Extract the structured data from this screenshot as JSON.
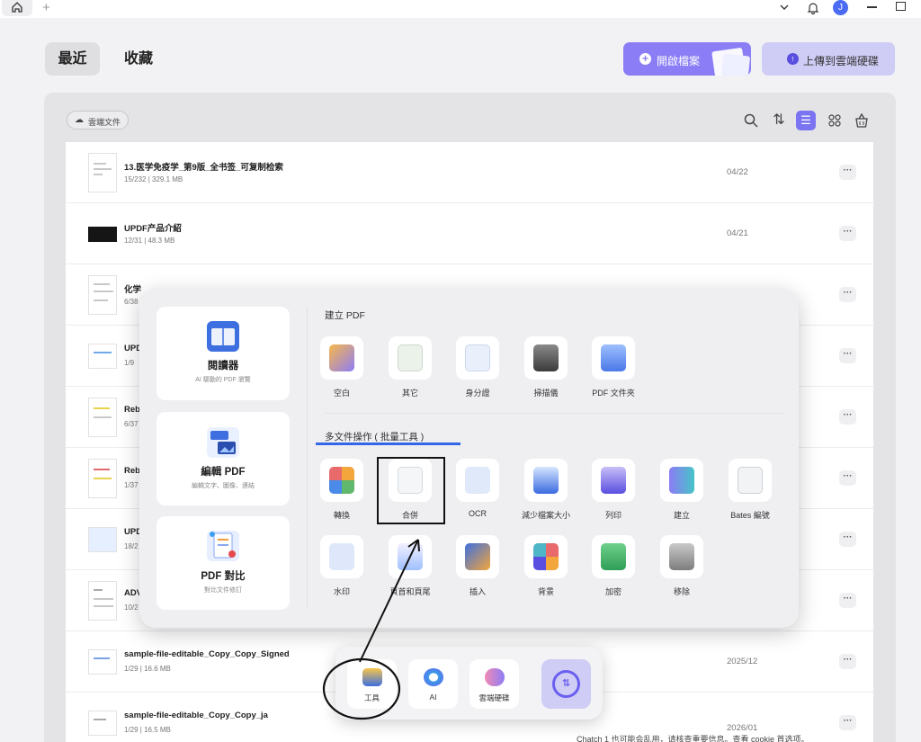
{
  "topbar": {
    "avatar_letter": "J"
  },
  "header": {
    "tab_recent": "最近",
    "tab_favorites": "收藏",
    "open_file": "開啟檔案",
    "upload_cloud": "上傳到雲端硬碟"
  },
  "toolbar": {
    "cloud_docs": "雲端文件"
  },
  "files": [
    {
      "name": "13.医学免疫学_第9版_全书签_可复制检索",
      "meta": "15/232 | 329.1 MB",
      "date": "04/22"
    },
    {
      "name": "UPDF产品介紹",
      "meta": "12/31 | 48.3 MB",
      "date": "04/21"
    },
    {
      "name": "化学",
      "meta": "6/38",
      "date": ""
    },
    {
      "name": "UPD",
      "meta": "1/9",
      "date": ""
    },
    {
      "name": "Reb",
      "meta": "6/37",
      "date": ""
    },
    {
      "name": "Reb",
      "meta": "1/37",
      "date": ""
    },
    {
      "name": "UPD",
      "meta": "18/2",
      "date": ""
    },
    {
      "name": "ADV",
      "meta": "10/2",
      "date": ""
    },
    {
      "name": "sample-file-editable_Copy_Copy_Signed",
      "meta": "1/29 | 16.6 MB",
      "date": "2025/12"
    },
    {
      "name": "sample-file-editable_Copy_Copy_ja",
      "meta": "1/29 | 16.5 MB",
      "date": "2026/01"
    }
  ],
  "popup": {
    "cards": [
      {
        "title": "閱讀器",
        "sub": "AI 驅動的 PDF 瀏覽"
      },
      {
        "title": "編輯 PDF",
        "sub": "編輯文字、圖像、連結"
      },
      {
        "title": "PDF 對比",
        "sub": "對比文件修訂"
      }
    ],
    "create_title": "建立 PDF",
    "create_items": [
      "空白",
      "其它",
      "身分證",
      "掃描儀",
      "PDF 文件夾"
    ],
    "batch_title": "多文件操作 ( 批量工具 )",
    "batch_row1": [
      "轉換",
      "合併",
      "OCR",
      "減少檔案大小",
      "列印",
      "建立",
      "Bates 編號"
    ],
    "batch_row2": [
      "水印",
      "頁首和頁尾",
      "插入",
      "背景",
      "加密",
      "移除"
    ]
  },
  "dock": {
    "tools": "工具",
    "ai": "AI",
    "cloud": "雲端硬碟"
  },
  "footer_text": "Chatch 1 也可能会乱用，请核查重要信息。查看 cookie 首选项。",
  "colors": {
    "accent": "#8a7df5",
    "accent_light": "#cfcdf5",
    "highlight_line": "#3467e6"
  }
}
